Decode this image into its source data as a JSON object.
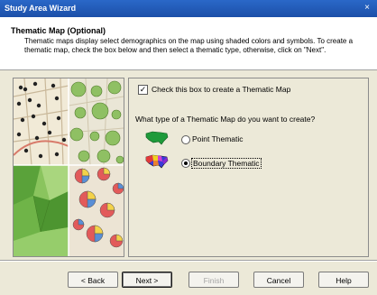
{
  "window": {
    "title": "Study Area Wizard",
    "close_glyph": "×"
  },
  "header": {
    "title": "Thematic Map (Optional)",
    "description": "Thematic maps display select demographics on the map using shaded colors and symbols.  To create a thematic map, check the box below and then select a thematic type, otherwise, click on \"Next\"."
  },
  "form": {
    "create_checkbox": {
      "label": "Check this box to create a Thematic Map",
      "checked": true,
      "mark": "✓"
    },
    "question": "What type of a Thematic Map do you want to create?",
    "options": [
      {
        "label": "Point Thematic",
        "selected": false,
        "icon": "us-map-green-icon"
      },
      {
        "label": "Boundary Thematic",
        "selected": true,
        "icon": "us-map-multicolor-icon"
      }
    ]
  },
  "buttons": {
    "back": "< Back",
    "next": "Next >",
    "finish": "Finish",
    "cancel": "Cancel",
    "help": "Help"
  },
  "colors": {
    "title_bar": "#2a68c8",
    "dialog_bg": "#ece9d8"
  }
}
